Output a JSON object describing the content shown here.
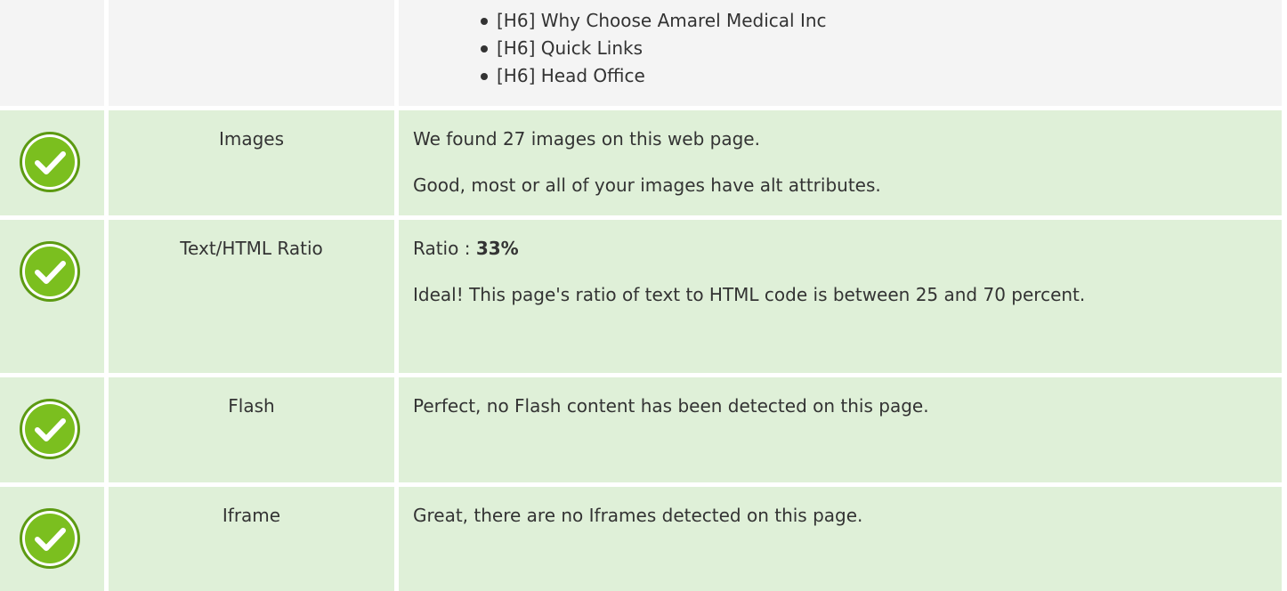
{
  "colors": {
    "passed_row": "#dff0d8",
    "neutral_row": "#f4f4f4",
    "check_green": "#7bbf1f",
    "text": "#333333"
  },
  "headings": {
    "items": [
      "[H6] Why Choose Amarel Medical Inc",
      "[H6] Quick Links",
      "[H6] Head Office"
    ]
  },
  "checks": [
    {
      "status": "passed",
      "icon": "checkmark-circle-icon",
      "label": "Images",
      "lines": [
        "We found 27 images on this web page.",
        "Good, most or all of your images have alt attributes."
      ]
    },
    {
      "status": "passed",
      "icon": "checkmark-circle-icon",
      "label": "Text/HTML Ratio",
      "ratio_prefix": "Ratio : ",
      "ratio_value": "33%",
      "lines": [
        "Ideal! This page's ratio of text to HTML code is between 25 and 70 percent."
      ]
    },
    {
      "status": "passed",
      "icon": "checkmark-circle-icon",
      "label": "Flash",
      "lines": [
        "Perfect, no Flash content has been detected on this page."
      ]
    },
    {
      "status": "passed",
      "icon": "checkmark-circle-icon",
      "label": "Iframe",
      "lines": [
        "Great, there are no Iframes detected on this page."
      ]
    }
  ]
}
